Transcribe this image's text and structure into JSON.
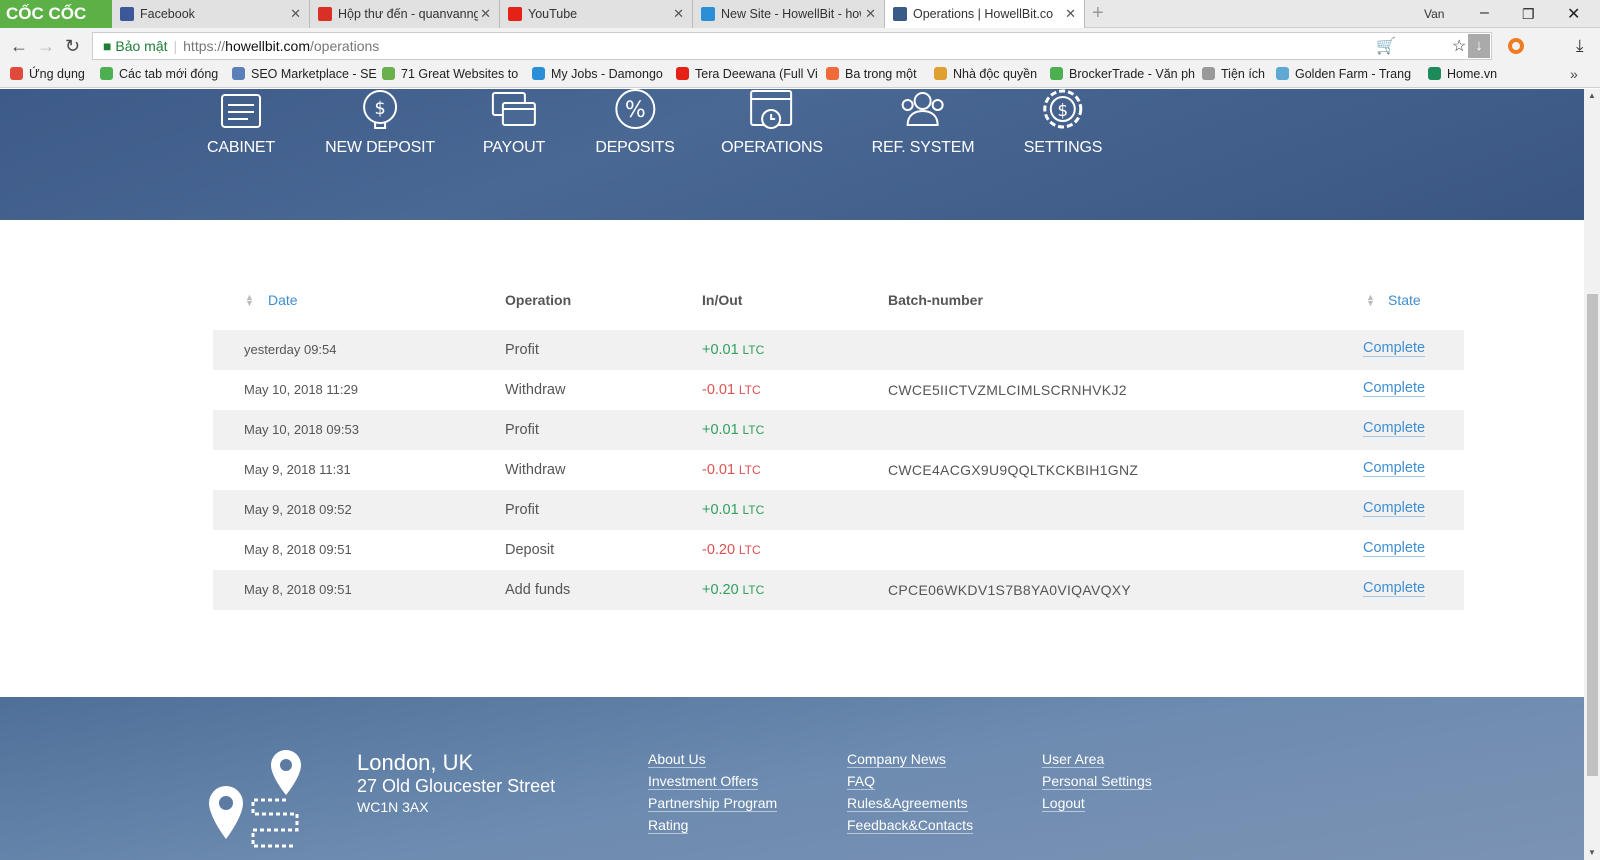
{
  "browser": {
    "brand": "CỐC CỐC",
    "tabs": [
      {
        "title": "Facebook",
        "icon": "facebook-icon",
        "color": "#3b5998"
      },
      {
        "title": "Hộp thư đến - quanvanng",
        "icon": "gmail-icon",
        "color": "#d93025"
      },
      {
        "title": "YouTube",
        "icon": "youtube-icon",
        "color": "#e62117"
      },
      {
        "title": "New Site - HowellBit - how",
        "icon": "howellbit-icon",
        "color": "#2a8fd6"
      },
      {
        "title": "Operations | HowellBit.com",
        "icon": "howellbit-icon",
        "color": "#3a5a88",
        "active": true
      }
    ],
    "user": "Van",
    "security_label": "Bảo mật",
    "url_scheme": "https://",
    "url_host": "howellbit.com",
    "url_path": "/operations",
    "bookmarks": [
      {
        "label": "Ứng dụng",
        "color": "#e04a3b"
      },
      {
        "label": "Các tab mới đóng",
        "color": "#4caf50"
      },
      {
        "label": "SEO Marketplace - SE",
        "color": "#5b7fb8"
      },
      {
        "label": "71 Great Websites to",
        "color": "#6ab04c"
      },
      {
        "label": "My Jobs - Damongo",
        "color": "#2a8fd6"
      },
      {
        "label": "Tera Deewana (Full Vi",
        "color": "#e62117"
      },
      {
        "label": "Ba trong một",
        "color": "#f06a3a"
      },
      {
        "label": "Nhà độc quyền",
        "color": "#e0a030"
      },
      {
        "label": "BrockerTrade - Văn ph",
        "color": "#4caf50"
      },
      {
        "label": "Tiện ích",
        "color": "#999999"
      },
      {
        "label": "Golden Farm - Trang",
        "color": "#5fa8d3"
      },
      {
        "label": "Home.vn",
        "color": "#1d8a5a"
      }
    ]
  },
  "nav": [
    {
      "label": "CABINET",
      "icon": "cabinet-icon"
    },
    {
      "label": "NEW DEPOSIT",
      "icon": "dollar-bulb-icon"
    },
    {
      "label": "PAYOUT",
      "icon": "cards-icon"
    },
    {
      "label": "DEPOSITS",
      "icon": "percent-icon"
    },
    {
      "label": "OPERATIONS",
      "icon": "calendar-clock-icon"
    },
    {
      "label": "REF. SYSTEM",
      "icon": "users-icon"
    },
    {
      "label": "SETTINGS",
      "icon": "dollar-gear-icon"
    }
  ],
  "table": {
    "headers": {
      "date": "Date",
      "operation": "Operation",
      "inout": "In/Out",
      "batch": "Batch-number",
      "state": "State"
    },
    "rows": [
      {
        "date": "yesterday 09:54",
        "operation": "Profit",
        "amount": "+0.01",
        "currency": "LTC",
        "batch": "",
        "state": "Complete"
      },
      {
        "date": "May 10, 2018 11:29",
        "operation": "Withdraw",
        "amount": "-0.01",
        "currency": "LTC",
        "batch": "CWCE5IICTVZMLCIMLSCRNHVKJ2",
        "state": "Complete"
      },
      {
        "date": "May 10, 2018 09:53",
        "operation": "Profit",
        "amount": "+0.01",
        "currency": "LTC",
        "batch": "",
        "state": "Complete"
      },
      {
        "date": "May 9, 2018 11:31",
        "operation": "Withdraw",
        "amount": "-0.01",
        "currency": "LTC",
        "batch": "CWCE4ACGX9U9QQLTKCKBIH1GNZ",
        "state": "Complete"
      },
      {
        "date": "May 9, 2018 09:52",
        "operation": "Profit",
        "amount": "+0.01",
        "currency": "LTC",
        "batch": "",
        "state": "Complete"
      },
      {
        "date": "May 8, 2018 09:51",
        "operation": "Deposit",
        "amount": "-0.20",
        "currency": "LTC",
        "batch": "",
        "state": "Complete"
      },
      {
        "date": "May 8, 2018 09:51",
        "operation": "Add funds",
        "amount": "+0.20",
        "currency": "LTC",
        "batch": "CPCE06WKDV1S7B8YA0VIQAVQXY",
        "state": "Complete"
      }
    ]
  },
  "footer": {
    "city": "London, UK",
    "street": "27 Old Gloucester Street",
    "postcode": "WC1N 3AX",
    "columns": [
      [
        "About Us",
        "Investment Offers",
        "Partnership Program",
        "Rating"
      ],
      [
        "Company News",
        "FAQ",
        "Rules&Agreements",
        "Feedback&Contacts"
      ],
      [
        "User Area",
        "Personal Settings",
        "Logout"
      ]
    ]
  },
  "colors": {
    "positive": "#2e9f5c",
    "negative": "#d9534f",
    "link": "#3f8ed4",
    "hero": "#3d5a88"
  }
}
